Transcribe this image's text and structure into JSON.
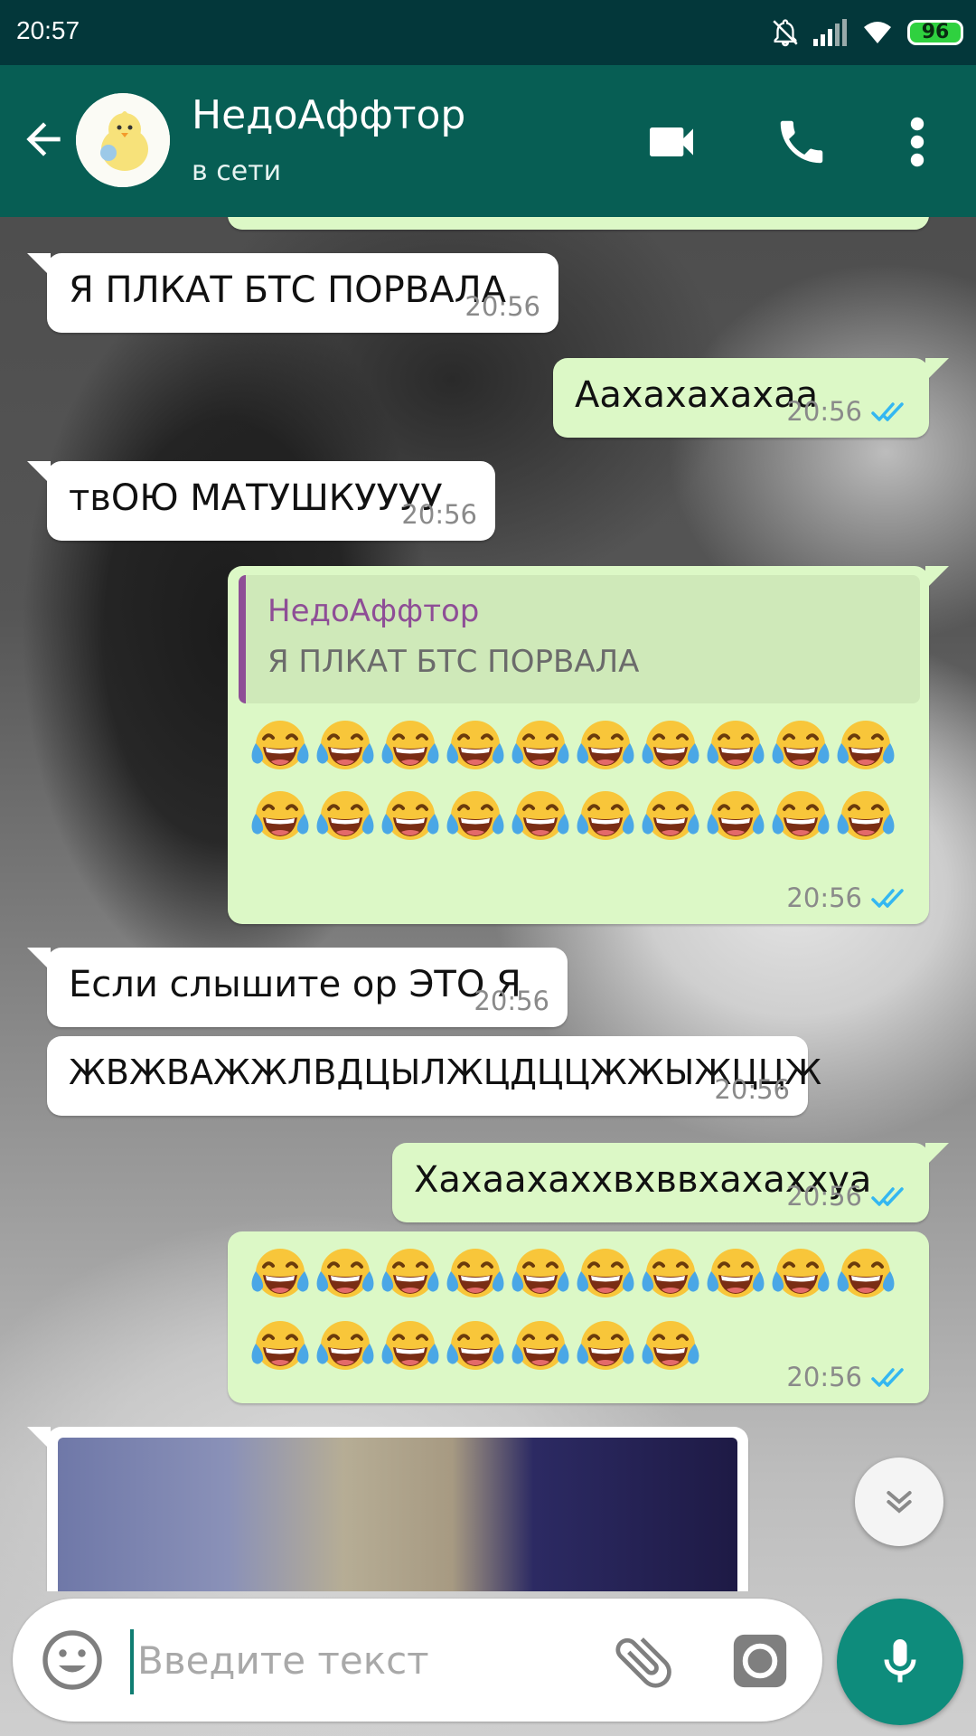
{
  "status_bar": {
    "time": "20:57",
    "battery": "96"
  },
  "header": {
    "contact_name": "НедоАффтор",
    "contact_status": "в сети"
  },
  "messages": [
    {
      "direction": "in",
      "text": "Я ПЛКАТ БТС ПОРВАЛА",
      "time": "20:56"
    },
    {
      "direction": "out",
      "text": "Аахахахахаа",
      "time": "20:56",
      "status": "read"
    },
    {
      "direction": "in",
      "text": "твОЮ МАТУШКУУУУ",
      "time": "20:56"
    },
    {
      "direction": "out",
      "quote": {
        "author": "НедоАффтор",
        "text": "Я ПЛКАТ БТС ПОРВАЛА"
      },
      "emoji": "😂",
      "emoji_count": 20,
      "time": "20:56",
      "status": "read"
    },
    {
      "direction": "in",
      "text": "Если слышите ор ЭТО Я",
      "time": "20:56"
    },
    {
      "direction": "in",
      "text": "ЖВЖВАЖЖЛВДЦЫЛЖЦДЦЦЖЖЫЖЦЦЖ",
      "time": "20:56"
    },
    {
      "direction": "out",
      "text": "Хахаахаххвхввхахаххуа",
      "time": "20:56",
      "status": "read"
    },
    {
      "direction": "out",
      "emoji": "😂",
      "emoji_count": 17,
      "time": "20:56",
      "status": "read"
    },
    {
      "direction": "in",
      "type": "video"
    }
  ],
  "composer": {
    "placeholder": "Введите текст"
  },
  "icons": [
    "back-arrow-icon",
    "video-call-icon",
    "phone-icon",
    "more-vert-icon",
    "emoji-icon",
    "attach-icon",
    "camera-icon",
    "mic-icon",
    "double-chevron-down-icon",
    "double-check-icon"
  ],
  "colors": {
    "header": "#075e54",
    "status_bar": "#03373a",
    "outgoing_bubble": "#dcf8c6",
    "incoming_bubble": "#ffffff",
    "read_ticks": "#34b7f1",
    "quote_accent": "#8e4e96",
    "mic_button": "#0e8c7c"
  }
}
